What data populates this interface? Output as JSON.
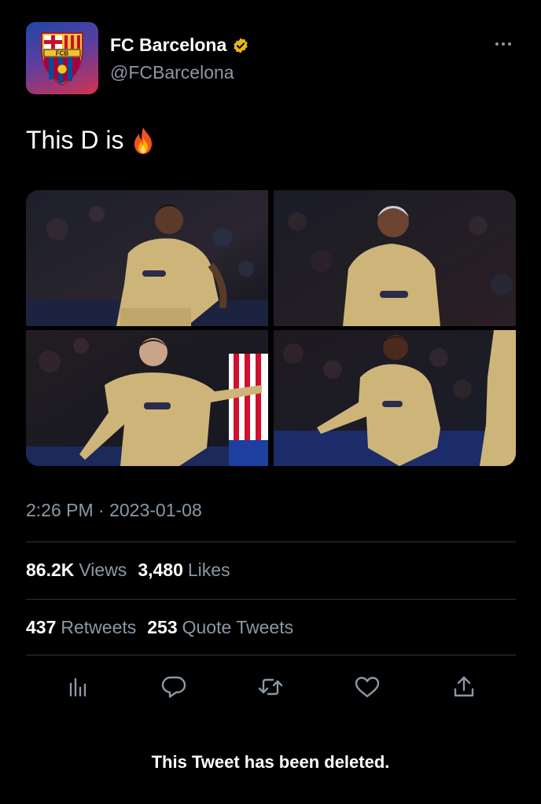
{
  "account": {
    "name": "FC Barcelona",
    "handle": "@FCBarcelona",
    "crest_text": "FCB"
  },
  "tweet": {
    "text": "This D is",
    "emoji_icon": "fire-emoji",
    "media_count": 4,
    "timestamp": "2:26 PM · 2023-01-08"
  },
  "stats": {
    "views": {
      "value": "86.2K",
      "label": "Views"
    },
    "likes": {
      "value": "3,480",
      "label": "Likes"
    },
    "retweets": {
      "value": "437",
      "label": "Retweets"
    },
    "quote_tweets": {
      "value": "253",
      "label": "Quote Tweets"
    }
  },
  "actions": [
    "analytics-icon",
    "reply-icon",
    "retweet-icon",
    "like-icon",
    "share-icon"
  ],
  "notice": "This Tweet has been deleted.",
  "colors": {
    "background": "#000000",
    "primary_text": "#ffffff",
    "secondary_text": "#8b98a5",
    "divider": "#2f3336",
    "verified_badge": "#e2b719",
    "kit_gold": "#cdb57a"
  }
}
